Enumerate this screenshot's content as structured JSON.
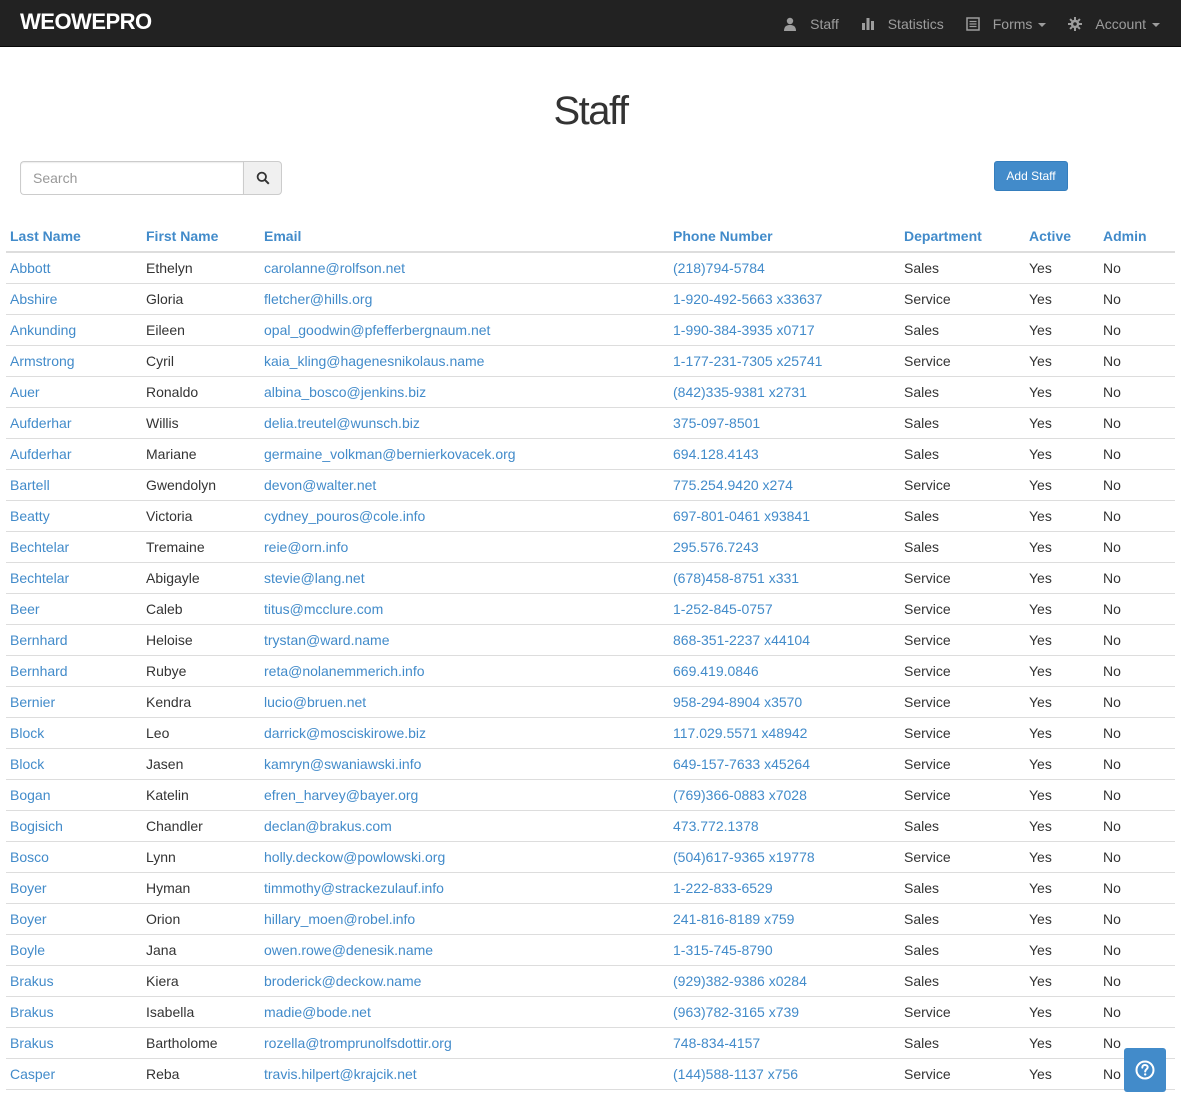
{
  "navbar": {
    "brand": "WEOWEPRO",
    "items": [
      {
        "label": "Staff",
        "icon": "user-icon"
      },
      {
        "label": "Statistics",
        "icon": "bar-chart-icon"
      },
      {
        "label": "Forms",
        "icon": "list-alt-icon",
        "dropdown": true
      },
      {
        "label": "Account",
        "icon": "gear-icon",
        "dropdown": true
      }
    ]
  },
  "page": {
    "title": "Staff",
    "search_placeholder": "Search",
    "add_label": "Add Staff"
  },
  "table": {
    "columns": [
      "Last Name",
      "First Name",
      "Email",
      "Phone Number",
      "Department",
      "Active",
      "Admin"
    ],
    "rows": [
      [
        "Abbott",
        "Ethelyn",
        "carolanne@rolfson.net",
        "(218)794-5784",
        "Sales",
        "Yes",
        "No"
      ],
      [
        "Abshire",
        "Gloria",
        "fletcher@hills.org",
        "1-920-492-5663 x33637",
        "Service",
        "Yes",
        "No"
      ],
      [
        "Ankunding",
        "Eileen",
        "opal_goodwin@pfefferbergnaum.net",
        "1-990-384-3935 x0717",
        "Sales",
        "Yes",
        "No"
      ],
      [
        "Armstrong",
        "Cyril",
        "kaia_kling@hagenesnikolaus.name",
        "1-177-231-7305 x25741",
        "Service",
        "Yes",
        "No"
      ],
      [
        "Auer",
        "Ronaldo",
        "albina_bosco@jenkins.biz",
        "(842)335-9381 x2731",
        "Sales",
        "Yes",
        "No"
      ],
      [
        "Aufderhar",
        "Willis",
        "delia.treutel@wunsch.biz",
        "375-097-8501",
        "Sales",
        "Yes",
        "No"
      ],
      [
        "Aufderhar",
        "Mariane",
        "germaine_volkman@bernierkovacek.org",
        "694.128.4143",
        "Sales",
        "Yes",
        "No"
      ],
      [
        "Bartell",
        "Gwendolyn",
        "devon@walter.net",
        "775.254.9420 x274",
        "Service",
        "Yes",
        "No"
      ],
      [
        "Beatty",
        "Victoria",
        "cydney_pouros@cole.info",
        "697-801-0461 x93841",
        "Sales",
        "Yes",
        "No"
      ],
      [
        "Bechtelar",
        "Tremaine",
        "reie@orn.info",
        "295.576.7243",
        "Sales",
        "Yes",
        "No"
      ],
      [
        "Bechtelar",
        "Abigayle",
        "stevie@lang.net",
        "(678)458-8751 x331",
        "Service",
        "Yes",
        "No"
      ],
      [
        "Beer",
        "Caleb",
        "titus@mcclure.com",
        "1-252-845-0757",
        "Service",
        "Yes",
        "No"
      ],
      [
        "Bernhard",
        "Heloise",
        "trystan@ward.name",
        "868-351-2237 x44104",
        "Service",
        "Yes",
        "No"
      ],
      [
        "Bernhard",
        "Rubye",
        "reta@nolanemmerich.info",
        "669.419.0846",
        "Service",
        "Yes",
        "No"
      ],
      [
        "Bernier",
        "Kendra",
        "lucio@bruen.net",
        "958-294-8904 x3570",
        "Service",
        "Yes",
        "No"
      ],
      [
        "Block",
        "Leo",
        "darrick@mosciskirowe.biz",
        "117.029.5571 x48942",
        "Service",
        "Yes",
        "No"
      ],
      [
        "Block",
        "Jasen",
        "kamryn@swaniawski.info",
        "649-157-7633 x45264",
        "Service",
        "Yes",
        "No"
      ],
      [
        "Bogan",
        "Katelin",
        "efren_harvey@bayer.org",
        "(769)366-0883 x7028",
        "Service",
        "Yes",
        "No"
      ],
      [
        "Bogisich",
        "Chandler",
        "declan@brakus.com",
        "473.772.1378",
        "Sales",
        "Yes",
        "No"
      ],
      [
        "Bosco",
        "Lynn",
        "holly.deckow@powlowski.org",
        "(504)617-9365 x19778",
        "Service",
        "Yes",
        "No"
      ],
      [
        "Boyer",
        "Hyman",
        "timmothy@strackezulauf.info",
        "1-222-833-6529",
        "Sales",
        "Yes",
        "No"
      ],
      [
        "Boyer",
        "Orion",
        "hillary_moen@robel.info",
        "241-816-8189 x759",
        "Sales",
        "Yes",
        "No"
      ],
      [
        "Boyle",
        "Jana",
        "owen.rowe@denesik.name",
        "1-315-745-8790",
        "Sales",
        "Yes",
        "No"
      ],
      [
        "Brakus",
        "Kiera",
        "broderick@deckow.name",
        "(929)382-9386 x0284",
        "Sales",
        "Yes",
        "No"
      ],
      [
        "Brakus",
        "Isabella",
        "madie@bode.net",
        "(963)782-3165 x739",
        "Service",
        "Yes",
        "No"
      ],
      [
        "Brakus",
        "Bartholome",
        "rozella@tromprunolfsdottir.org",
        "748-834-4157",
        "Sales",
        "Yes",
        "No"
      ],
      [
        "Casper",
        "Reba",
        "travis.hilpert@krajcik.net",
        "(144)588-1137 x756",
        "Service",
        "Yes",
        "No"
      ]
    ]
  },
  "help": {
    "icon": "question-icon"
  },
  "colors": {
    "navbar_bg": "#222222",
    "link": "#428bca",
    "button": "#428bca"
  }
}
